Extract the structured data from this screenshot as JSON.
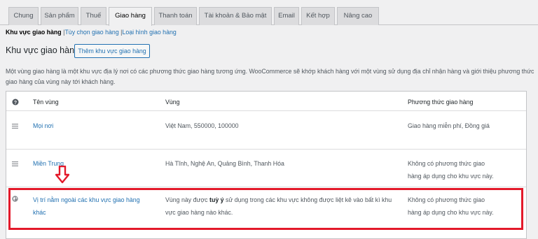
{
  "tabs": [
    {
      "label": "Chung"
    },
    {
      "label": "Sản phẩm"
    },
    {
      "label": "Thuế"
    },
    {
      "label": "Giao hàng",
      "active": true
    },
    {
      "label": "Thanh toán"
    },
    {
      "label": "Tài khoản & Bảo mật"
    },
    {
      "label": "Email"
    },
    {
      "label": "Kết hợp"
    },
    {
      "label": "Nâng cao"
    }
  ],
  "subnav": {
    "current": "Khu vực giao hàng",
    "separator": "|",
    "links": [
      "Tùy chọn giao hàng",
      "Loại hình giao hàng"
    ]
  },
  "section": {
    "title": "Khu vực giao hàng",
    "add_button": "Thêm khu vực giao hàng",
    "description": "Một vùng giao hàng là một khu vực địa lý nơi có các phương thức giao hàng tương ứng. WooCommerce sẽ khớp khách hàng với một vùng sử dụng địa chỉ nhận hàng và giới thiệu phương thức giao hàng của vùng này tới khách hàng."
  },
  "table": {
    "headers": {
      "name": "Tên vùng",
      "region": "Vùng",
      "methods": "Phương thức giao hàng"
    },
    "rows": [
      {
        "name": "Mọi nơi",
        "region": "Việt Nam, 550000, 100000",
        "methods": "Giao hàng miễn phí, Đồng giá",
        "icon": "drag-handle-icon"
      },
      {
        "name": "Miền Trung",
        "region": "Hà Tĩnh, Nghệ An, Quảng Bình, Thanh Hóa",
        "methods": "Không có phương thức giao hàng áp dụng cho khu vực này.",
        "icon": "drag-handle-icon"
      },
      {
        "name": "Vị trí nằm ngoài các khu vực giao hàng khác",
        "region_pre": "Vùng này được ",
        "region_bold": "tuỳ ý",
        "region_post": " sử dụng trong các khu vực không được liệt kê vào bất kì khu vực giao hàng nào khác.",
        "methods": "Không có phương thức giao hàng áp dụng cho khu vực này.",
        "icon": "globe-icon"
      }
    ]
  },
  "annotation": {
    "color": "#e3192a",
    "icon": "down-arrow-icon"
  },
  "colors": {
    "link": "#2271b1",
    "background": "#f0f0f1",
    "highlight": "#e3192a"
  }
}
